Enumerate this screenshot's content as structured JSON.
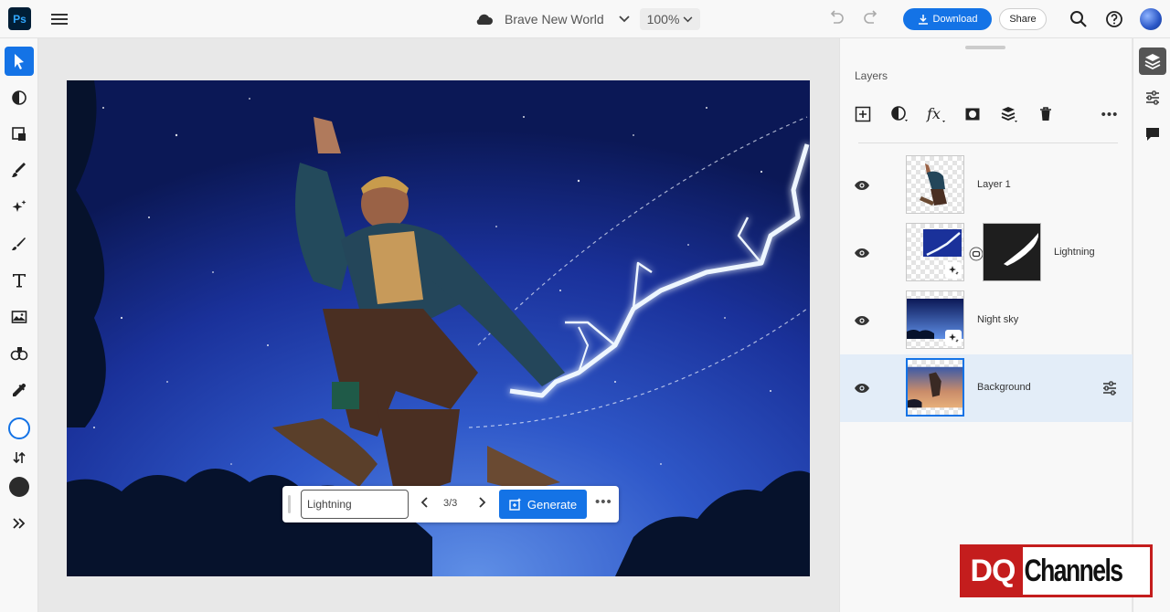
{
  "app": {
    "logo_text": "Ps"
  },
  "header": {
    "doc_title": "Brave New World",
    "zoom": "100%",
    "download_label": "Download",
    "share_label": "Share"
  },
  "toolbar": {
    "tools": [
      "select-icon",
      "adjust-icon",
      "quick-actions-icon",
      "brush-icon",
      "spot-heal-icon",
      "paint-icon",
      "type-icon",
      "image-icon",
      "clone-icon",
      "eyedropper-icon",
      "stroke-color-icon",
      "swap-icon",
      "fill-color-icon",
      "expand-icon"
    ],
    "active_tool": "select-icon"
  },
  "context_bar": {
    "prompt_value": "Lightning",
    "count": "3/3",
    "generate_label": "Generate"
  },
  "layers_panel": {
    "title": "Layers",
    "layers": [
      {
        "name": "Layer 1",
        "selected": false
      },
      {
        "name": "Lightning",
        "selected": false,
        "has_mask": true
      },
      {
        "name": "Night sky",
        "selected": false
      },
      {
        "name": "Background",
        "selected": true
      }
    ]
  },
  "watermark": {
    "left": "DQ",
    "right": "Channels"
  },
  "colors": {
    "accent": "#1473e6",
    "selected_row": "#e3edf8",
    "brand_red": "#c41d1d"
  }
}
